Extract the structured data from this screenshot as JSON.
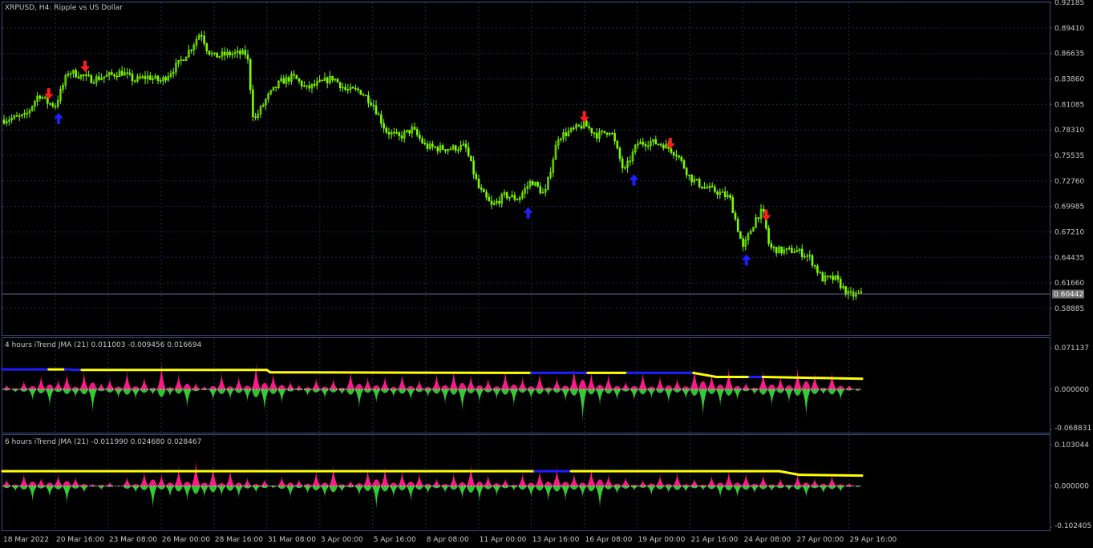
{
  "colors": {
    "background": "#000000",
    "panel_border": "#3d4c7e",
    "grid": "#1f2a55",
    "text": "#c8c8c8",
    "candle": "#7cfc00",
    "arrow_up": "#1e1eff",
    "arrow_down": "#ff1e1e",
    "hist_pos": "#ff1a8c",
    "hist_neg": "#32cd32",
    "line_yellow": "#ffff00",
    "line_blue": "#1e1eff",
    "price_box": "#6a6a6a"
  },
  "chart_data": [
    {
      "panel": "main",
      "type": "candlestick",
      "title": "XRPUSD, H4:  Ripple vs US Dollar",
      "symbol": "XRPUSD",
      "timeframe": "H4",
      "ylim": [
        0.56,
        0.92185
      ],
      "yticks": [
        "0.92185",
        "0.89410",
        "0.86635",
        "0.83860",
        "0.81085",
        "0.78310",
        "0.75535",
        "0.72760",
        "0.69985",
        "0.67210",
        "0.64435",
        "0.61660",
        "0.58885"
      ],
      "current_price": "0.60442",
      "xticks": [
        "18 Mar 2022",
        "20 Mar 16:00",
        "23 Mar 08:00",
        "26 Mar 00:00",
        "28 Mar 16:00",
        "31 Mar 08:00",
        "3 Apr 00:00",
        "5 Apr 16:00",
        "8 Apr 08:00",
        "11 Apr 00:00",
        "13 Apr 16:00",
        "16 Apr 08:00",
        "19 Apr 00:00",
        "21 Apr 16:00",
        "24 Apr 08:00",
        "27 Apr 00:00",
        "29 Apr 16:00"
      ],
      "close_path": [
        {
          "t": "18 Mar 2022",
          "close": 0.794
        },
        {
          "t": "19 Mar 04:00",
          "close": 0.798
        },
        {
          "t": "19 Mar 20:00",
          "close": 0.822
        },
        {
          "t": "20 Mar 08:00",
          "close": 0.812
        },
        {
          "t": "20 Mar 16:00",
          "close": 0.81
        },
        {
          "t": "21 Mar 08:00",
          "close": 0.847
        },
        {
          "t": "21 Mar 20:00",
          "close": 0.843
        },
        {
          "t": "22 Mar 12:00",
          "close": 0.838
        },
        {
          "t": "23 Mar 08:00",
          "close": 0.842
        },
        {
          "t": "24 Mar 00:00",
          "close": 0.846
        },
        {
          "t": "24 Mar 16:00",
          "close": 0.837
        },
        {
          "t": "25 Mar 08:00",
          "close": 0.841
        },
        {
          "t": "26 Mar 00:00",
          "close": 0.836
        },
        {
          "t": "26 Mar 20:00",
          "close": 0.854
        },
        {
          "t": "27 Mar 12:00",
          "close": 0.872
        },
        {
          "t": "28 Mar 00:00",
          "close": 0.89
        },
        {
          "t": "28 Mar 08:00",
          "close": 0.87
        },
        {
          "t": "28 Mar 16:00",
          "close": 0.863
        },
        {
          "t": "29 Mar 12:00",
          "close": 0.866
        },
        {
          "t": "30 Mar 08:00",
          "close": 0.866
        },
        {
          "t": "30 Mar 16:00",
          "close": 0.792
        },
        {
          "t": "31 Mar 08:00",
          "close": 0.818
        },
        {
          "t": "1 Apr 00:00",
          "close": 0.835
        },
        {
          "t": "1 Apr 16:00",
          "close": 0.841
        },
        {
          "t": "2 Apr 08:00",
          "close": 0.828
        },
        {
          "t": "3 Apr 00:00",
          "close": 0.834
        },
        {
          "t": "3 Apr 16:00",
          "close": 0.84
        },
        {
          "t": "4 Apr 08:00",
          "close": 0.826
        },
        {
          "t": "5 Apr 00:00",
          "close": 0.826
        },
        {
          "t": "5 Apr 16:00",
          "close": 0.812
        },
        {
          "t": "6 Apr 08:00",
          "close": 0.782
        },
        {
          "t": "7 Apr 00:00",
          "close": 0.775
        },
        {
          "t": "7 Apr 16:00",
          "close": 0.784
        },
        {
          "t": "8 Apr 08:00",
          "close": 0.765
        },
        {
          "t": "9 Apr 00:00",
          "close": 0.763
        },
        {
          "t": "9 Apr 16:00",
          "close": 0.763
        },
        {
          "t": "10 Apr 08:00",
          "close": 0.765
        },
        {
          "t": "11 Apr 00:00",
          "close": 0.72
        },
        {
          "t": "11 Apr 16:00",
          "close": 0.7
        },
        {
          "t": "12 Apr 08:00",
          "close": 0.712
        },
        {
          "t": "13 Apr 00:00",
          "close": 0.708
        },
        {
          "t": "13 Apr 16:00",
          "close": 0.728
        },
        {
          "t": "14 Apr 08:00",
          "close": 0.712
        },
        {
          "t": "15 Apr 00:00",
          "close": 0.775
        },
        {
          "t": "15 Apr 16:00",
          "close": 0.782
        },
        {
          "t": "16 Apr 08:00",
          "close": 0.789
        },
        {
          "t": "17 Apr 00:00",
          "close": 0.777
        },
        {
          "t": "17 Apr 16:00",
          "close": 0.783
        },
        {
          "t": "18 Apr 08:00",
          "close": 0.737
        },
        {
          "t": "19 Apr 00:00",
          "close": 0.768
        },
        {
          "t": "19 Apr 16:00",
          "close": 0.77
        },
        {
          "t": "20 Apr 08:00",
          "close": 0.767
        },
        {
          "t": "21 Apr 00:00",
          "close": 0.757
        },
        {
          "t": "21 Apr 16:00",
          "close": 0.731
        },
        {
          "t": "22 Apr 08:00",
          "close": 0.721
        },
        {
          "t": "23 Apr 00:00",
          "close": 0.716
        },
        {
          "t": "23 Apr 16:00",
          "close": 0.709
        },
        {
          "t": "24 Apr 08:00",
          "close": 0.654
        },
        {
          "t": "25 Apr 00:00",
          "close": 0.688
        },
        {
          "t": "25 Apr 08:00",
          "close": 0.695
        },
        {
          "t": "25 Apr 16:00",
          "close": 0.655
        },
        {
          "t": "26 Apr 08:00",
          "close": 0.651
        },
        {
          "t": "27 Apr 00:00",
          "close": 0.652
        },
        {
          "t": "27 Apr 16:00",
          "close": 0.645
        },
        {
          "t": "28 Apr 08:00",
          "close": 0.621
        },
        {
          "t": "29 Apr 00:00",
          "close": 0.621
        },
        {
          "t": "29 Apr 16:00",
          "close": 0.603
        },
        {
          "t": "30 Apr 08:00",
          "close": 0.604
        }
      ],
      "signals": [
        {
          "type": "down",
          "t": "20 Mar 08:00",
          "price": 0.818
        },
        {
          "type": "up",
          "t": "20 Mar 20:00",
          "price": 0.8
        },
        {
          "type": "down",
          "t": "22 Mar 04:00",
          "price": 0.848
        },
        {
          "type": "up",
          "t": "13 Apr 12:00",
          "price": 0.697
        },
        {
          "type": "down",
          "t": "16 Apr 08:00",
          "price": 0.793
        },
        {
          "type": "up",
          "t": "18 Apr 20:00",
          "price": 0.733
        },
        {
          "type": "down",
          "t": "20 Apr 16:00",
          "price": 0.764
        },
        {
          "type": "up",
          "t": "24 Apr 12:00",
          "price": 0.646
        },
        {
          "type": "down",
          "t": "25 Apr 12:00",
          "price": 0.686
        }
      ]
    },
    {
      "panel": "indicator1",
      "type": "area",
      "title": "4 hours iTrend JMA (21) 0.011003 -0.009456 0.016694",
      "ylim": [
        -0.068831,
        0.071137
      ],
      "yticks": [
        "0.071137",
        "0.000000",
        "-0.068831"
      ],
      "trend_line": [
        {
          "t": "18 Mar 2022",
          "value": 0.034,
          "color": "blue"
        },
        {
          "t": "20 Mar 08:00",
          "value": 0.034,
          "color": "yellow"
        },
        {
          "t": "21 Mar 04:00",
          "value": 0.034,
          "color": "blue"
        },
        {
          "t": "22 Mar 00:00",
          "value": 0.033,
          "color": "yellow"
        },
        {
          "t": "31 Mar 08:00",
          "value": 0.033,
          "color": "yellow"
        },
        {
          "t": "31 Mar 12:00",
          "value": 0.029,
          "color": "yellow"
        },
        {
          "t": "13 Apr 16:00",
          "value": 0.028,
          "color": "blue"
        },
        {
          "t": "16 Apr 12:00",
          "value": 0.028,
          "color": "yellow"
        },
        {
          "t": "18 Apr 12:00",
          "value": 0.028,
          "color": "blue"
        },
        {
          "t": "21 Apr 20:00",
          "value": 0.028,
          "color": "yellow"
        },
        {
          "t": "23 Apr 00:00",
          "value": 0.021,
          "color": "yellow"
        },
        {
          "t": "24 Apr 16:00",
          "value": 0.021,
          "color": "blue"
        },
        {
          "t": "25 Apr 08:00",
          "value": 0.021,
          "color": "yellow"
        },
        {
          "t": "30 Apr 08:00",
          "value": 0.018,
          "color": "yellow"
        }
      ],
      "histogram_note": "pink = positive, green = negative oscillation around zero",
      "histogram": [
        0.008,
        -0.006,
        0.015,
        -0.02,
        0.025,
        -0.03,
        0.018,
        0.03,
        -0.015,
        0.032,
        -0.042,
        0.012,
        0.02,
        -0.016,
        0.034,
        -0.018,
        0.022,
        -0.01,
        0.048,
        -0.012,
        0.028,
        -0.034,
        0.012,
        0.006,
        -0.02,
        0.03,
        -0.018,
        0.024,
        -0.022,
        0.05,
        -0.04,
        0.03,
        -0.026,
        0.014,
        0.008,
        -0.012,
        0.02,
        -0.016,
        0.02,
        -0.01,
        0.034,
        -0.034,
        0.022,
        -0.024,
        0.024,
        -0.014,
        0.028,
        -0.02,
        0.018,
        -0.014,
        0.028,
        -0.026,
        0.034,
        -0.04,
        0.026,
        -0.024,
        0.02,
        -0.018,
        0.034,
        -0.03,
        0.022,
        -0.018,
        0.03,
        -0.012,
        0.022,
        -0.022,
        0.04,
        -0.06,
        0.032,
        -0.028,
        0.028,
        -0.02,
        0.014,
        -0.02,
        0.032,
        -0.016,
        0.024,
        -0.024,
        0.02,
        -0.018,
        0.04,
        -0.05,
        0.03,
        -0.03,
        0.04,
        -0.02,
        0.012,
        -0.01,
        0.034,
        -0.03,
        0.024,
        -0.024,
        0.04,
        -0.05,
        0.03,
        -0.01,
        0.032,
        -0.02,
        0.008,
        -0.004
      ]
    },
    {
      "panel": "indicator2",
      "type": "area",
      "title": "6 hours iTrend JMA (21) -0.011990 0.024680 0.028467",
      "ylim": [
        -0.102405,
        0.103044
      ],
      "yticks": [
        "0.103044",
        "0.000000",
        "-0.102405"
      ],
      "trend_line": [
        {
          "t": "18 Mar 2022",
          "value": 0.037,
          "color": "yellow"
        },
        {
          "t": "13 Apr 20:00",
          "value": 0.037,
          "color": "blue"
        },
        {
          "t": "15 Apr 16:00",
          "value": 0.037,
          "color": "yellow"
        },
        {
          "t": "26 Apr 04:00",
          "value": 0.037,
          "color": "yellow"
        },
        {
          "t": "27 Apr 04:00",
          "value": 0.028,
          "color": "yellow"
        },
        {
          "t": "30 Apr 08:00",
          "value": 0.026,
          "color": "yellow"
        }
      ],
      "histogram": [
        0.018,
        -0.014,
        0.032,
        -0.04,
        0.022,
        -0.03,
        0.03,
        -0.046,
        0.024,
        -0.018,
        0.006,
        -0.01,
        0.01,
        -0.002,
        0.024,
        -0.018,
        0.038,
        -0.06,
        0.032,
        -0.03,
        0.05,
        -0.038,
        0.072,
        -0.03,
        0.056,
        -0.026,
        0.044,
        -0.03,
        0.022,
        -0.018,
        0.018,
        -0.006,
        0.026,
        -0.03,
        0.018,
        -0.02,
        0.04,
        -0.03,
        0.056,
        -0.016,
        0.014,
        -0.026,
        0.046,
        -0.06,
        0.05,
        -0.03,
        0.04,
        -0.04,
        0.034,
        -0.02,
        0.02,
        -0.018,
        0.034,
        -0.034,
        0.06,
        -0.04,
        0.03,
        -0.026,
        0.02,
        -0.012,
        0.034,
        -0.03,
        0.042,
        -0.04,
        0.05,
        -0.038,
        0.034,
        -0.03,
        0.048,
        -0.06,
        0.03,
        -0.022,
        0.024,
        -0.012,
        0.016,
        -0.024,
        0.03,
        -0.018,
        0.036,
        -0.016,
        0.02,
        -0.012,
        0.028,
        -0.03,
        0.04,
        -0.03,
        0.034,
        -0.02,
        0.03,
        -0.014,
        0.02,
        -0.012,
        0.032,
        -0.03,
        0.02,
        -0.02,
        0.028,
        -0.016,
        0.008,
        -0.004
      ]
    }
  ]
}
